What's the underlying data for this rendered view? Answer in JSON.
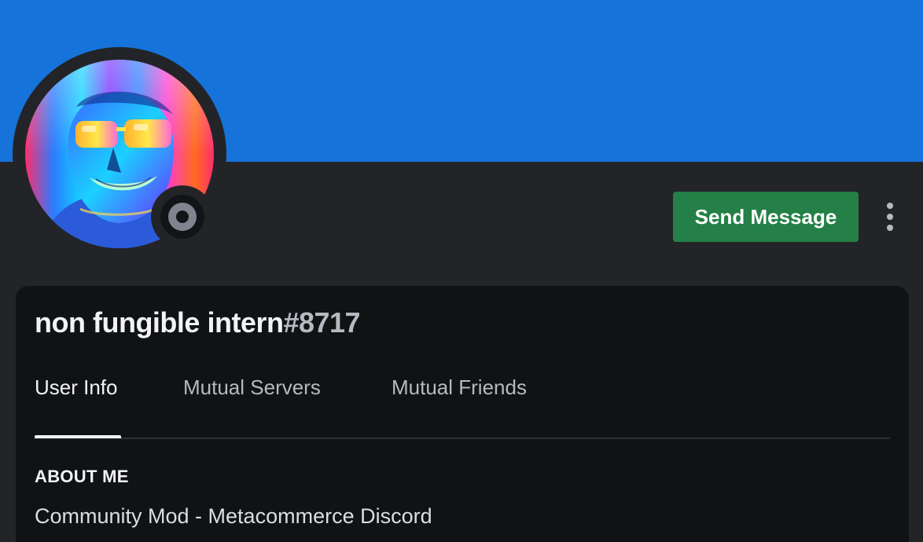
{
  "profile": {
    "display_name": "non fungible intern",
    "discriminator": "#8717",
    "status": "offline",
    "avatar_icon": "psychedelic-face-avatar"
  },
  "actions": {
    "send_message_label": "Send Message",
    "more_icon": "vertical-ellipsis-icon"
  },
  "tabs": [
    {
      "label": "User Info",
      "active": true
    },
    {
      "label": "Mutual Servers",
      "active": false
    },
    {
      "label": "Mutual Friends",
      "active": false
    }
  ],
  "about": {
    "heading": "ABOUT ME",
    "text": "Community Mod - Metacommerce Discord"
  },
  "colors": {
    "banner": "#1673d9",
    "background": "#232428",
    "card": "#111214",
    "send_button": "#248046",
    "status_offline": "#80848e"
  }
}
